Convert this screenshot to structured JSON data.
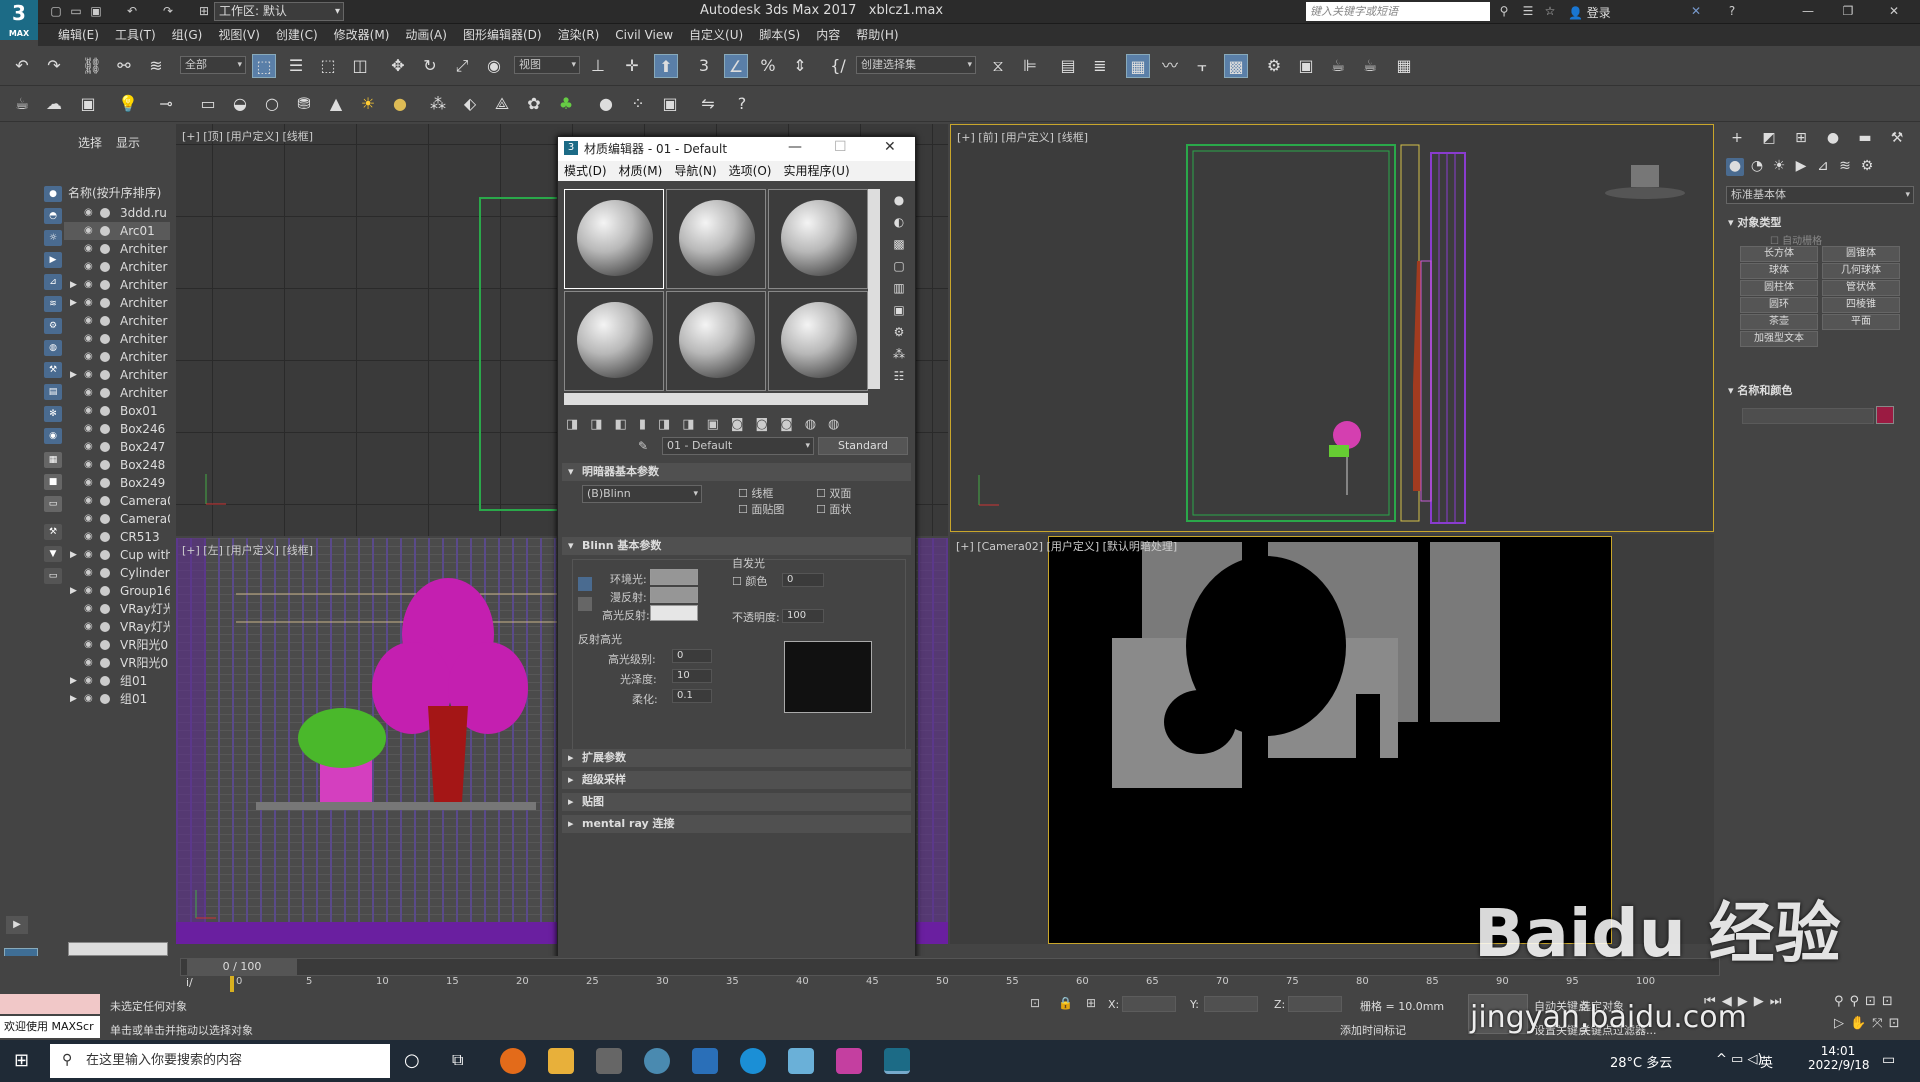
{
  "app": {
    "logo_text": "3",
    "logo_sub": "MAX",
    "title": "Autodesk 3ds Max 2017",
    "filename": "xblcz1.max",
    "workspace": "工作区: 默认",
    "search_placeholder": "键入关键字或短语",
    "login": "登录"
  },
  "menu": [
    "编辑(E)",
    "工具(T)",
    "组(G)",
    "视图(V)",
    "创建(C)",
    "修改器(M)",
    "动画(A)",
    "图形编辑器(D)",
    "渲染(R)",
    "Civil View",
    "自定义(U)",
    "脚本(S)",
    "内容",
    "帮助(H)"
  ],
  "toolbar": {
    "filter": "全部",
    "ref_coord": "视图",
    "named_set": "创建选择集"
  },
  "scene_explorer": {
    "tabs": [
      "选择",
      "显示"
    ],
    "header": "名称(按升序排序)",
    "rows": [
      {
        "name": "3ddd.ru",
        "expand": false
      },
      {
        "name": "Arc01",
        "expand": false
      },
      {
        "name": "Architer",
        "expand": false
      },
      {
        "name": "Architer",
        "expand": false
      },
      {
        "name": "Architer",
        "expand": true
      },
      {
        "name": "Architer",
        "expand": true
      },
      {
        "name": "Architer",
        "expand": false
      },
      {
        "name": "Architer",
        "expand": false
      },
      {
        "name": "Architer",
        "expand": false
      },
      {
        "name": "Architer",
        "expand": true
      },
      {
        "name": "Architer",
        "expand": false
      },
      {
        "name": "Box01",
        "expand": false
      },
      {
        "name": "Box246",
        "expand": false
      },
      {
        "name": "Box247",
        "expand": false
      },
      {
        "name": "Box248",
        "expand": false
      },
      {
        "name": "Box249",
        "expand": false
      },
      {
        "name": "Camera0",
        "expand": false
      },
      {
        "name": "Camera0",
        "expand": false
      },
      {
        "name": "CR513",
        "expand": false
      },
      {
        "name": "Cup with",
        "expand": true
      },
      {
        "name": "Cylinder0",
        "expand": false
      },
      {
        "name": "Group16",
        "expand": true
      },
      {
        "name": "VRay灯光",
        "expand": false
      },
      {
        "name": "VRay灯光",
        "expand": false
      },
      {
        "name": "VR阳光0",
        "expand": false
      },
      {
        "name": "VR阳光0",
        "expand": false
      },
      {
        "name": "组01",
        "expand": true
      },
      {
        "name": "组01",
        "expand": true
      }
    ]
  },
  "viewports": {
    "top": "[+] [顶] [用户定义] [线框]",
    "front": "[+] [前] [用户定义] [线框]",
    "left": "[+] [左] [用户定义] [线框]",
    "camera": "[+] [Camera02] [用户定义] [默认明暗处理]"
  },
  "material_editor": {
    "title": "材质编辑器 - 01 - Default",
    "menu": [
      "模式(D)",
      "材质(M)",
      "导航(N)",
      "选项(O)",
      "实用程序(U)"
    ],
    "material_name": "01 - Default",
    "material_type": "Standard",
    "rollout_shader": "明暗器基本参数",
    "shader": "(B)Blinn",
    "checks": [
      "线框",
      "双面",
      "面贴图",
      "面状"
    ],
    "rollout_blinn": "Blinn 基本参数",
    "self_illum": "自发光",
    "color_label": "颜色",
    "color_value": "0",
    "ambient": "环境光:",
    "diffuse": "漫反射:",
    "specular": "高光反射:",
    "opacity_label": "不透明度:",
    "opacity": "100",
    "spec_highlights": "反射高光",
    "spec_level_label": "高光级别:",
    "spec_level": "0",
    "gloss_label": "光泽度:",
    "gloss": "10",
    "soften_label": "柔化:",
    "soften": "0.1",
    "rollouts_closed": [
      "扩展参数",
      "超级采样",
      "贴图",
      "mental ray 连接"
    ]
  },
  "command_panel": {
    "dropdown": "标准基本体",
    "section_object_type": "对象类型",
    "autogrid": "自动栅格",
    "buttons": [
      "长方体",
      "圆锥体",
      "球体",
      "几何球体",
      "圆柱体",
      "管状体",
      "圆环",
      "四棱锥",
      "茶壶",
      "平面",
      "加强型文本"
    ],
    "section_name_color": "名称和颜色",
    "color": "#9b1b42"
  },
  "timeline": {
    "frame": "0 / 100",
    "ticks": [
      "0",
      "5",
      "10",
      "15",
      "20",
      "25",
      "30",
      "35",
      "40",
      "45",
      "50",
      "55",
      "60",
      "65",
      "70",
      "75",
      "80",
      "85",
      "90",
      "95",
      "100"
    ]
  },
  "status": {
    "line1": "未选定任何对象",
    "line2": "单击或单击并拖动以选择对象",
    "maxscript": "欢迎使用 MAXScr",
    "x_label": "X:",
    "y_label": "Y:",
    "z_label": "Z:",
    "grid": "栅格 = 10.0mm",
    "add_time_tag": "添加时间标记",
    "auto_key": "自动关键点",
    "selected": "选定对象",
    "set_key": "设置关键点",
    "key_filters": "关键点过滤器..."
  },
  "taskbar": {
    "search": "在这里输入你要搜索的内容",
    "weather": "28°C 多云",
    "lang": "英",
    "time": "14:01",
    "date": "2022/9/18"
  },
  "watermark": {
    "brand": "Baidu 经验",
    "url": "jingyan.baidu.com"
  }
}
